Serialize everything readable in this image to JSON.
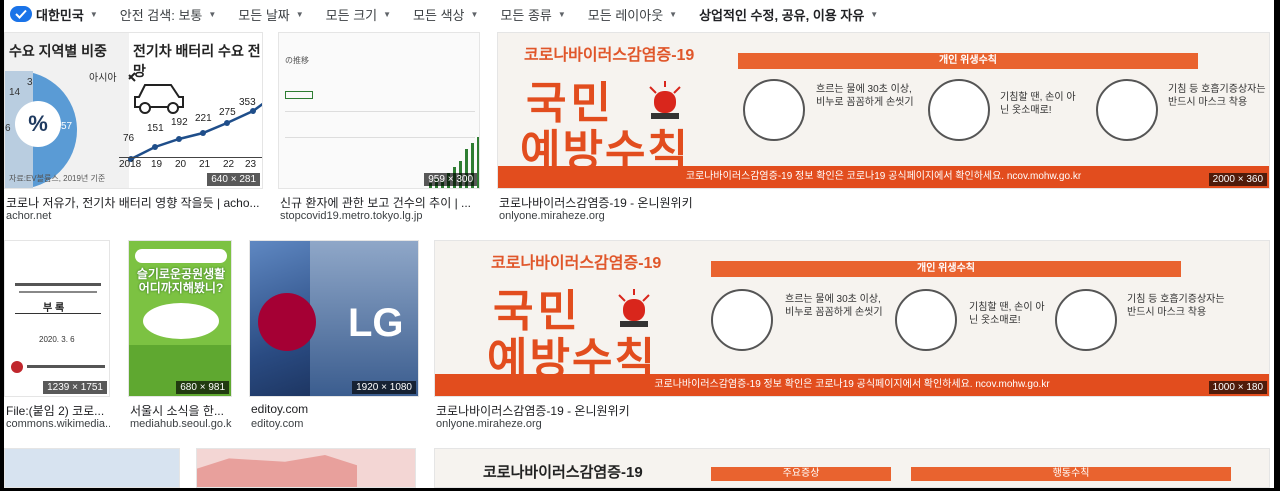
{
  "filters": {
    "region": "대한민국",
    "items": [
      "안전 검색: 보통",
      "모든 날짜",
      "모든 크기",
      "모든 색상",
      "모든 종류",
      "모든 레이아웃"
    ],
    "license": "상업적인 수정, 공유, 이용 자유"
  },
  "results": [
    {
      "title": "코로나 저유가, 전기차 배터리 영향 작을듯 | acho...",
      "domain": "achor.net",
      "dims": "640 × 281",
      "chart_title_left": "수요 지역별 비중",
      "chart_title_right": "전기차 배터리 수요 전망",
      "labels": [
        "3",
        "14",
        "57",
        "6",
        "아시아"
      ],
      "pct": "%",
      "line_values": [
        "76",
        "151",
        "192",
        "221",
        "275",
        "353"
      ],
      "years": [
        "2018",
        "19",
        "20",
        "21",
        "22",
        "23"
      ],
      "source": "자료:EV볼륨스, 2019년 기준"
    },
    {
      "title": "신규 환자에 관한 보고 건수의 추이 | ...",
      "domain": "stopcovid19.metro.tokyo.lg.jp",
      "dims": "959 × 300",
      "inner_text": "の推移"
    },
    {
      "title": "코로나바이러스감염증-19 - 온니원위키",
      "domain": "onlyone.miraheze.org",
      "dims": "2000 × 360"
    },
    {
      "title": "File:(붙임 2) 코로...",
      "domain": "commons.wikimedia...",
      "dims": "1239 × 1751",
      "doc_label": "부 록",
      "doc_date": "2020. 3. 6"
    },
    {
      "title": "서울시 소식을 한...",
      "domain": "mediahub.seoul.go.kr",
      "dims": "680 × 981",
      "poster_text": "슬기로운공원생활 어디까지해봤니?"
    },
    {
      "title": "editoy.com",
      "domain": "editoy.com",
      "dims": "1920 × 1080",
      "logo_text": "LG"
    },
    {
      "title": "코로나바이러스감염증-19 - 온니원위키",
      "domain": "onlyone.miraheze.org",
      "dims": "1000 × 180"
    }
  ],
  "poster": {
    "header": "코로나바이러스감염증-19",
    "line1": "국민",
    "line2": "예방수칙",
    "band": "개인 위생수칙",
    "tip1": "흐르는 물에 30초 이상, 비누로 꼼꼼하게 손씻기",
    "tip2": "기침할 땐, 손이 아닌 옷소매로!",
    "tip3": "기침 등 호흡기증상자는 반드시 마스크 착용",
    "footer": "코로나바이러스감염증-19 정보 확인은 코로나19 공식페이지에서 확인하세요. ncov.mohw.go.kr",
    "band2": "주요증상",
    "band3": "행동수칙"
  }
}
